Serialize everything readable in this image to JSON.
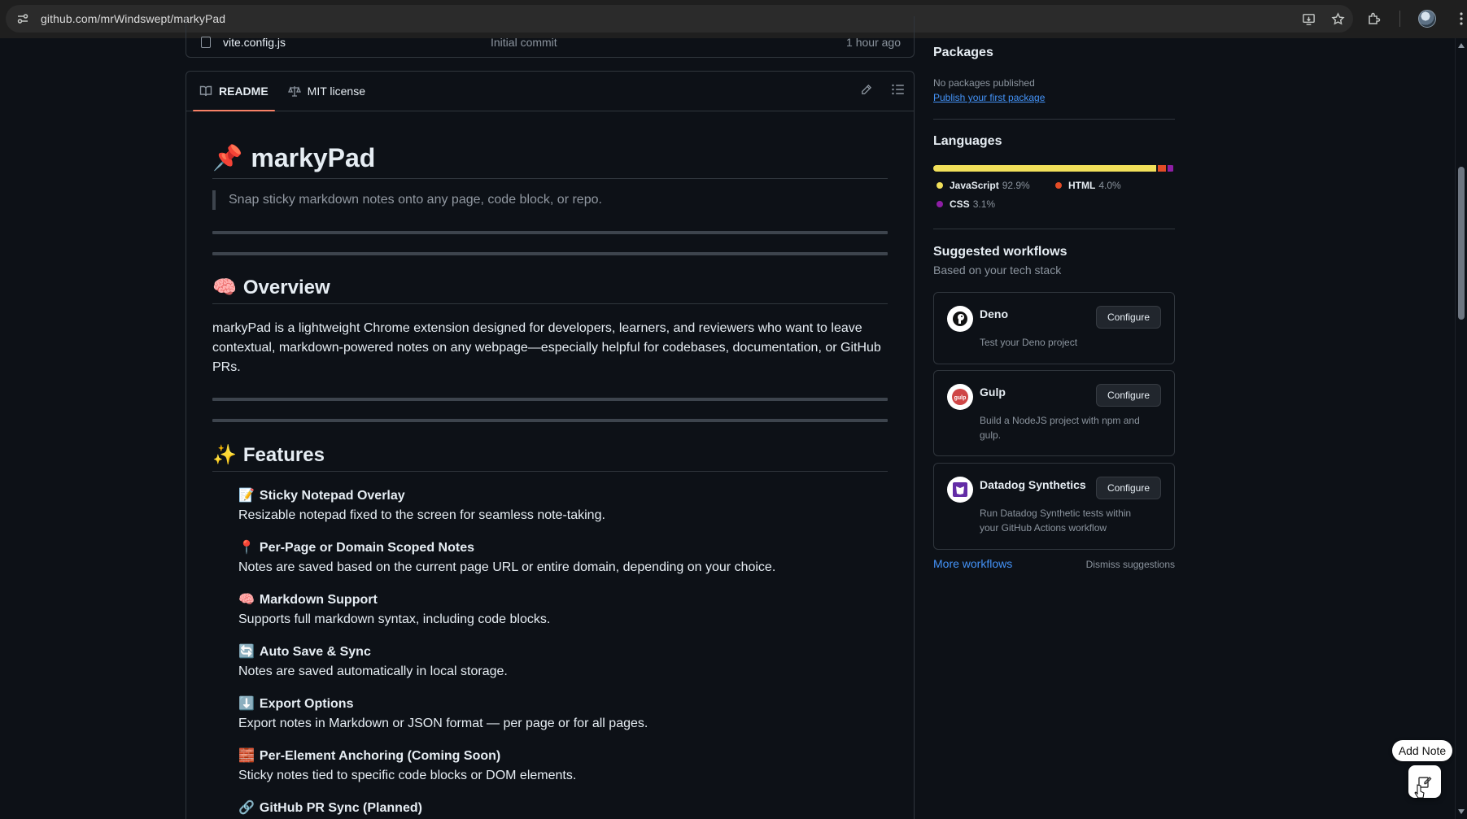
{
  "browser": {
    "url": "github.com/mrWindswept/markyPad"
  },
  "file_row": {
    "name": "vite.config.js",
    "message": "Initial commit",
    "date": "1 hour ago"
  },
  "readme": {
    "tabs": [
      {
        "label": "README"
      },
      {
        "label": "MIT license"
      }
    ],
    "title": "markyPad",
    "title_emoji": "📌",
    "tagline": "Snap sticky markdown notes onto any page, code block, or repo.",
    "overview": {
      "heading": "Overview",
      "emoji": "🧠",
      "text": "markyPad is a lightweight Chrome extension designed for developers, learners, and reviewers who want to leave contextual, markdown-powered notes on any webpage—especially helpful for codebases, documentation, or GitHub PRs."
    },
    "features": {
      "heading": "Features",
      "emoji": "✨",
      "items": [
        {
          "emoji": "📝",
          "title": "Sticky Notepad Overlay",
          "desc": "Resizable notepad fixed to the screen for seamless note-taking."
        },
        {
          "emoji": "📍",
          "title": "Per-Page or Domain Scoped Notes",
          "desc": "Notes are saved based on the current page URL or entire domain, depending on your choice."
        },
        {
          "emoji": "🧠",
          "title": "Markdown Support",
          "desc": "Supports full markdown syntax, including code blocks."
        },
        {
          "emoji": "🔄",
          "title": "Auto Save & Sync",
          "desc": "Notes are saved automatically in local storage."
        },
        {
          "emoji": "⬇️",
          "title": "Export Options",
          "desc": "Export notes in Markdown or JSON format — per page or for all pages."
        },
        {
          "emoji": "🧱",
          "title": "Per-Element Anchoring (Coming Soon)",
          "desc": "Sticky notes tied to specific code blocks or DOM elements."
        },
        {
          "emoji": "🔗",
          "title": "GitHub PR Sync (Planned)",
          "desc": ""
        }
      ]
    }
  },
  "sidebar": {
    "packages": {
      "heading": "Packages",
      "empty_text": "No packages published",
      "link": "Publish your first package"
    },
    "languages": {
      "heading": "Languages",
      "items": [
        {
          "name": "JavaScript",
          "percent": "92.9%",
          "value": 92.9,
          "color": "#f1e05a"
        },
        {
          "name": "HTML",
          "percent": "4.0%",
          "value": 4.0,
          "color": "#e34c26"
        },
        {
          "name": "CSS",
          "percent": "3.1%",
          "value": 3.1,
          "color": "#8e1ea5"
        }
      ]
    },
    "workflows": {
      "heading": "Suggested workflows",
      "subheading": "Based on your tech stack",
      "items": [
        {
          "name": "Deno",
          "desc": "Test your Deno project",
          "button": "Configure"
        },
        {
          "name": "Gulp",
          "desc": "Build a NodeJS project with npm and gulp.",
          "button": "Configure"
        },
        {
          "name": "Datadog Synthetics",
          "desc": "Run Datadog Synthetic tests within your GitHub Actions workflow",
          "button": "Configure"
        }
      ],
      "more_link": "More workflows",
      "dismiss": "Dismiss suggestions"
    }
  },
  "overlay": {
    "tooltip": "Add Note"
  }
}
